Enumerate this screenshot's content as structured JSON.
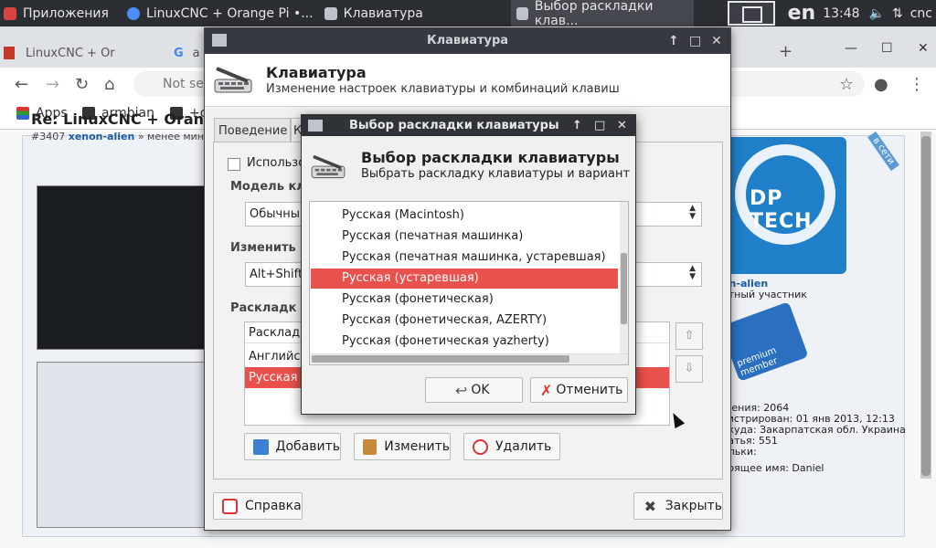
{
  "panel": {
    "tasks": [
      {
        "label": "Приложения"
      },
      {
        "label": "LinuxCNC + Orange Pi •..."
      },
      {
        "label": "Клавиатура"
      },
      {
        "label": "Выбор раскладки клав..."
      }
    ],
    "lang": "en",
    "time": "13:48",
    "user": "cnc"
  },
  "browser": {
    "tabs": [
      {
        "label": "LinuxCNC + Or"
      },
      {
        "label": "a"
      }
    ],
    "new_tab": "+",
    "omnibox": "Not se",
    "bookmarks": [
      {
        "label": "Apps"
      },
      {
        "label": "armbian"
      },
      {
        "label": "+c"
      }
    ],
    "post": {
      "title": "Re: LinuxCNC + Orange",
      "id": "#3407",
      "author": "xenon-alien",
      "meta_tail": "» менее мину"
    },
    "sidebar": {
      "nick": "on-alien",
      "role": "етный участник",
      "lines": [
        "щения: 2064",
        "гистрирован: 01 янв 2013, 12:13",
        "ткуда: Закарпатская обл. Украина",
        "татья: 551",
        "альки:",
        "тоящее имя: Daniel"
      ],
      "avatar_text": "DP TECH",
      "corner_text": "в сети",
      "badge_text": "premium member"
    }
  },
  "kb_window": {
    "title": "Клавиатура",
    "header_title": "Клавиатура",
    "header_sub": "Изменение настроек клавиатуры и комбинаций клавиш",
    "tab_behavior": "Поведение",
    "tab_k": "К",
    "use_check_label": "Использо",
    "model_label": "Модель кл",
    "model_value": "Обычны",
    "change_label": "Изменить",
    "change_value": "Alt+Shift",
    "layouts_label": "Раскладк",
    "layouts": [
      {
        "label": "Расклад",
        "selected": false
      },
      {
        "label": "Английск",
        "selected": false
      },
      {
        "label": "Русская",
        "selected": true
      }
    ],
    "btn_add": "Добавить",
    "btn_edit": "Изменить",
    "btn_delete": "Удалить",
    "btn_help": "Справка",
    "btn_close": "Закрыть"
  },
  "dialog": {
    "title": "Выбор раскладки клавиатуры",
    "header_title": "Выбор раскладки клавиатуры",
    "header_sub": "Выбрать раскладку клавиатуры и вариант",
    "items": [
      {
        "label": "Русская (Macintosh)",
        "selected": false
      },
      {
        "label": "Русская (печатная машинка)",
        "selected": false
      },
      {
        "label": "Русская (печатная машинка, устаревшая)",
        "selected": false
      },
      {
        "label": "Русская (устаревшая)",
        "selected": true
      },
      {
        "label": "Русская (фонетическая)",
        "selected": false
      },
      {
        "label": "Русская (фонетическая, AZERTY)",
        "selected": false
      },
      {
        "label": "Русская (фонетическая yazherty)",
        "selected": false
      }
    ],
    "btn_ok": "OK",
    "btn_cancel": "Отменить"
  },
  "colors": {
    "selection": "#e8514c",
    "panel_bg": "#2b2e33",
    "titlebar": "#363a40"
  }
}
